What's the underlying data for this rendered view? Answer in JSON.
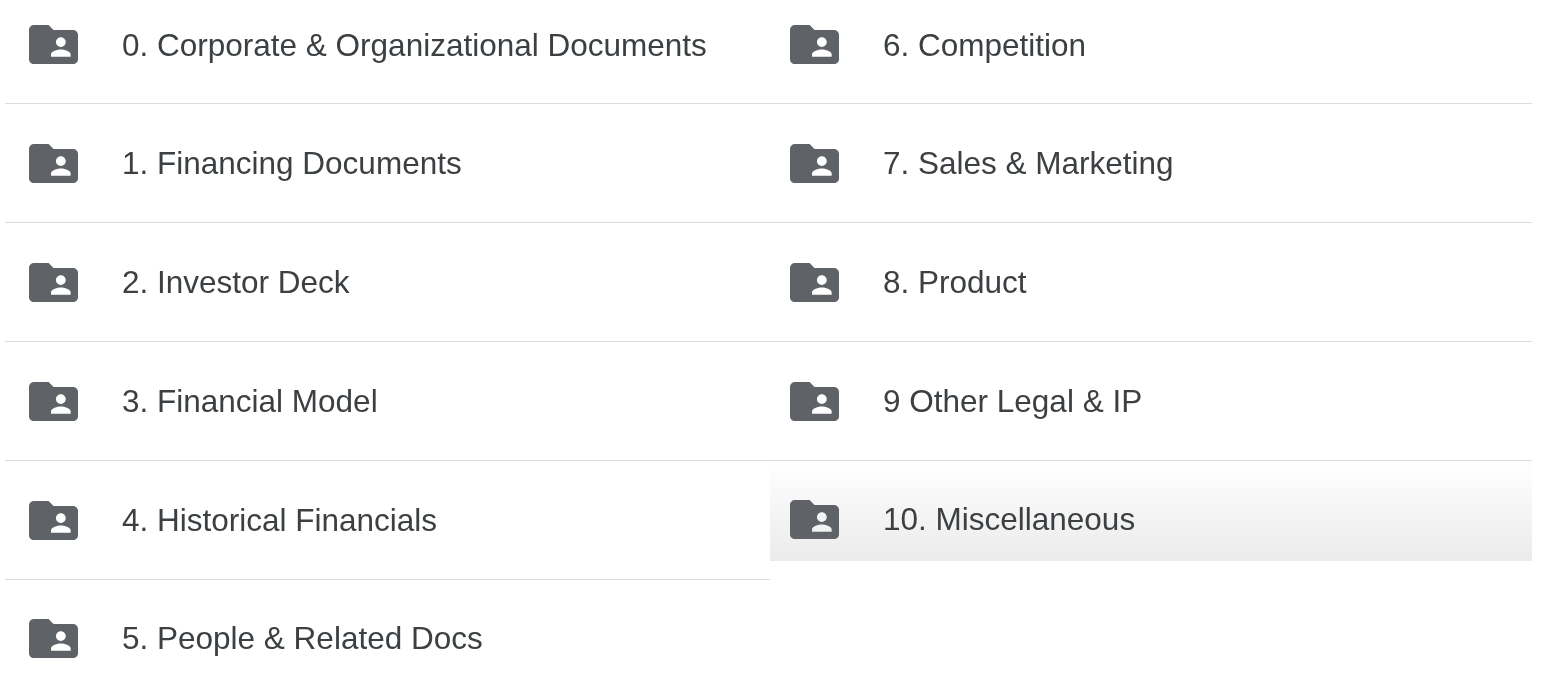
{
  "columns": [
    {
      "items": [
        {
          "label": "0. Corporate & Organizational Documents",
          "selected": false
        },
        {
          "label": "1. Financing Documents",
          "selected": false
        },
        {
          "label": "2. Investor Deck",
          "selected": false
        },
        {
          "label": "3. Financial Model",
          "selected": false
        },
        {
          "label": "4. Historical Financials",
          "selected": false
        },
        {
          "label": "5. People & Related Docs",
          "selected": false
        }
      ]
    },
    {
      "items": [
        {
          "label": "6. Competition",
          "selected": false
        },
        {
          "label": "7. Sales & Marketing",
          "selected": false
        },
        {
          "label": "8. Product",
          "selected": false
        },
        {
          "label": "9 Other Legal & IP",
          "selected": false
        },
        {
          "label": "10. Miscellaneous",
          "selected": true
        }
      ]
    }
  ]
}
